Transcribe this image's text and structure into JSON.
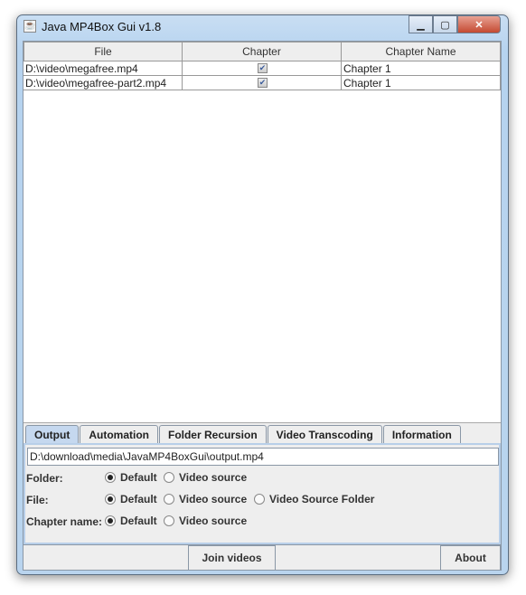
{
  "window": {
    "title": "Java MP4Box Gui v1.8",
    "icon": "java-icon"
  },
  "table": {
    "headers": [
      "File",
      "Chapter",
      "Chapter Name"
    ],
    "rows": [
      {
        "file": "D:\\video\\megafree.mp4",
        "chapter": true,
        "chapter_name": "Chapter 1"
      },
      {
        "file": "D:\\video\\megafree-part2.mp4",
        "chapter": true,
        "chapter_name": "Chapter 1"
      }
    ]
  },
  "tabs": [
    {
      "label": "Output",
      "active": true
    },
    {
      "label": "Automation"
    },
    {
      "label": "Folder Recursion"
    },
    {
      "label": "Video Transcoding"
    },
    {
      "label": "Information"
    }
  ],
  "output": {
    "path": "D:\\download\\media\\JavaMP4BoxGui\\output.mp4",
    "folder": {
      "label": "Folder:",
      "options": [
        "Default",
        "Video source"
      ],
      "selected": "Default"
    },
    "file": {
      "label": "File:",
      "options": [
        "Default",
        "Video source",
        "Video Source Folder"
      ],
      "selected": "Default"
    },
    "chapter_name": {
      "label": "Chapter name:",
      "options": [
        "Default",
        "Video source"
      ],
      "selected": "Default"
    }
  },
  "buttons": {
    "join": "Join videos",
    "about": "About"
  }
}
